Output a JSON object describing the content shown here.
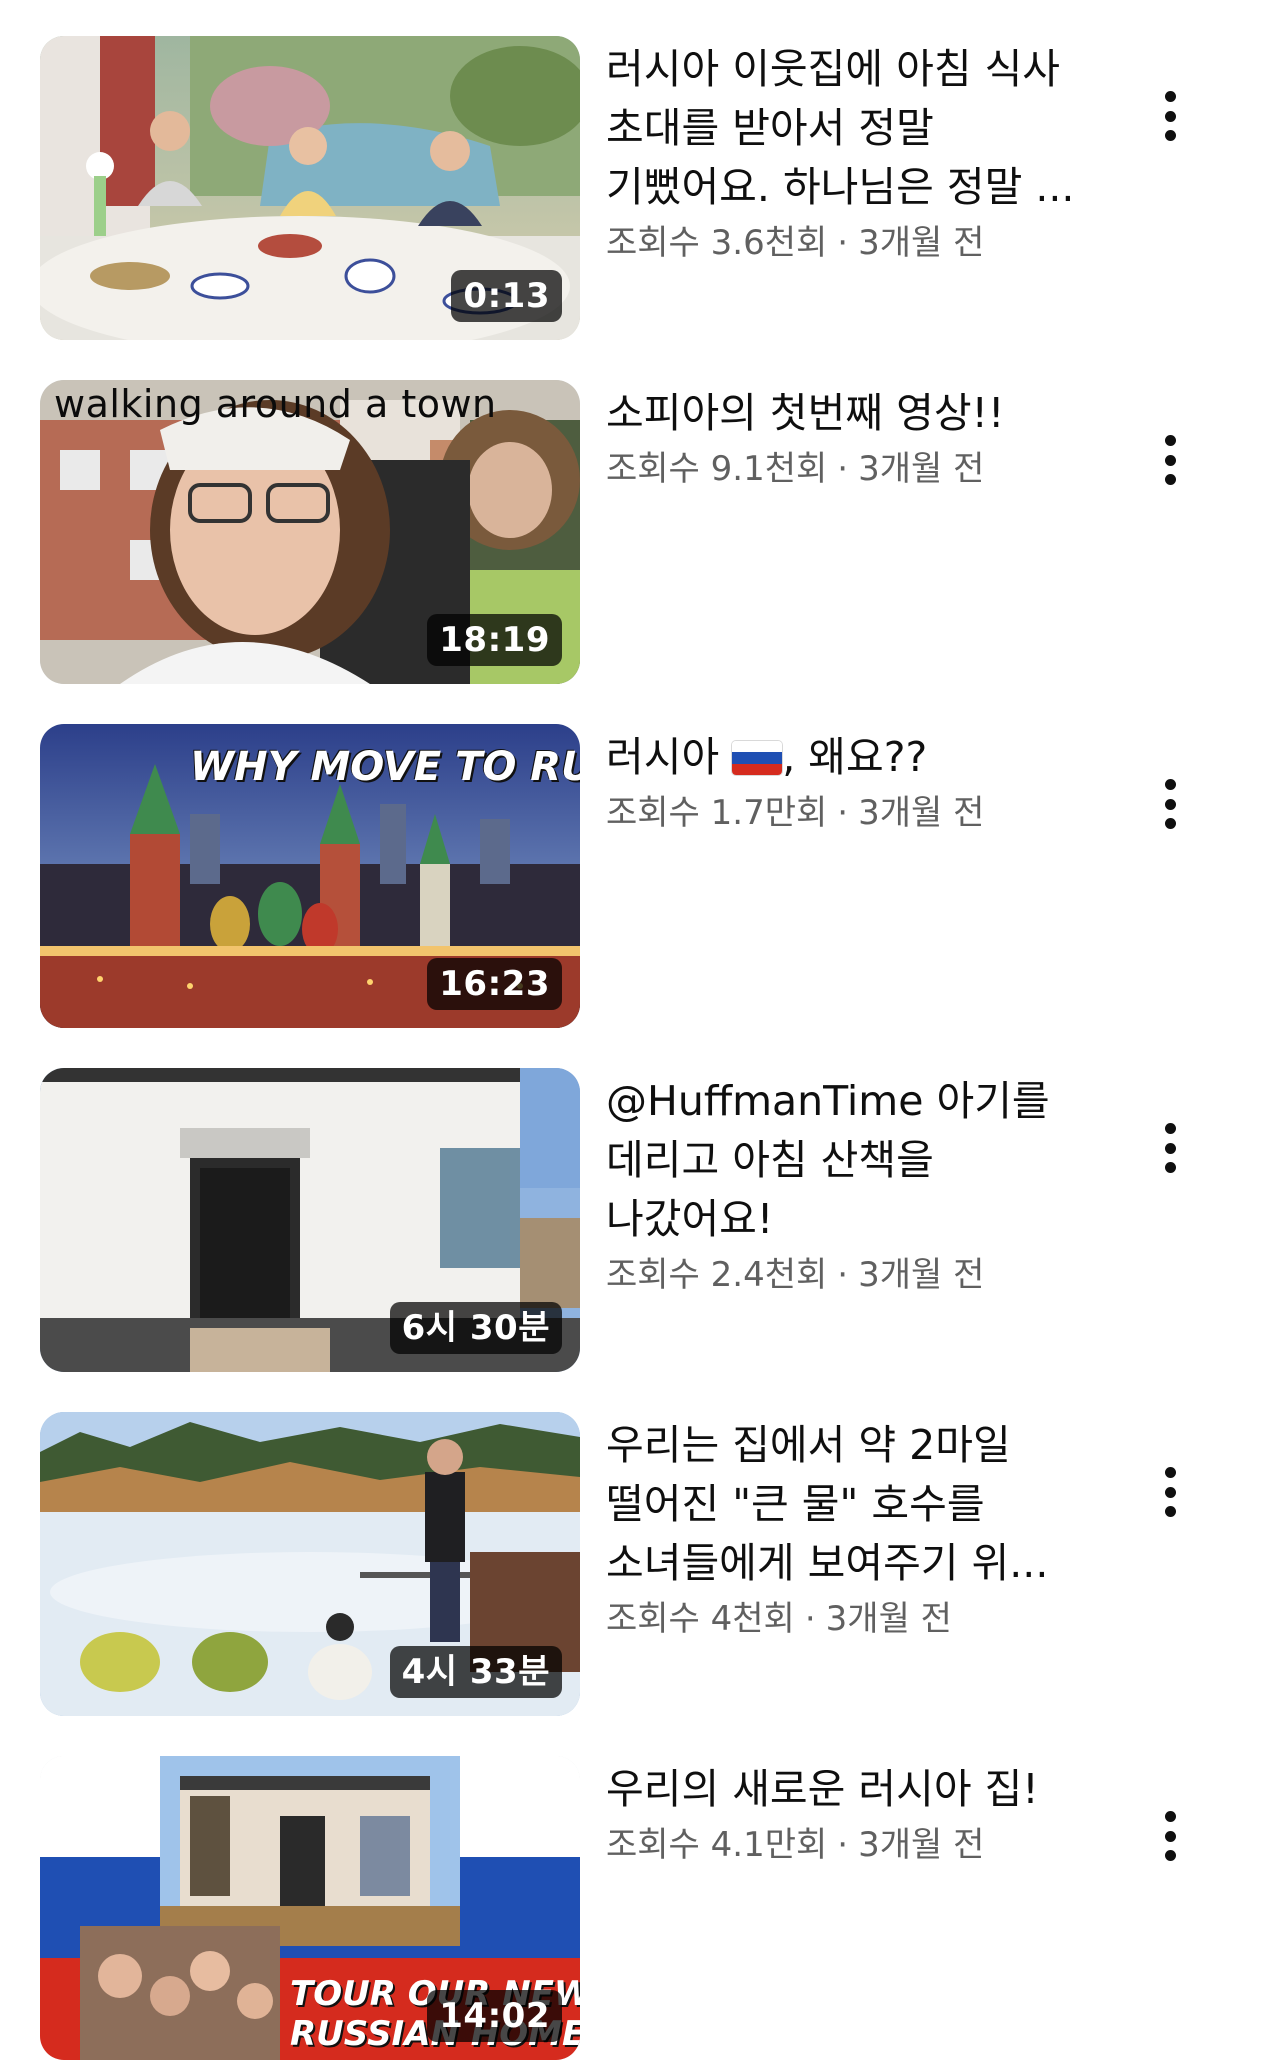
{
  "videos": [
    {
      "title": "러시아 이웃집에 아침 식사 초대를 받아서 정말 기뻤어요. 하나님은 정말 ...",
      "views": "조회수 3.6천회",
      "age": "3개월 전",
      "duration": "0:13",
      "thumbnail_text": ""
    },
    {
      "title": "소피아의 첫번째 영상!!",
      "views": "조회수 9.1천회",
      "age": "3개월 전",
      "duration": "18:19",
      "thumbnail_text": "walking around a town"
    },
    {
      "title_before_flag": "러시아 ",
      "title_after_flag": ", 왜요??",
      "views": "조회수 1.7만회",
      "age": "3개월 전",
      "duration": "16:23",
      "thumbnail_text": "WHY MOVE TO RUSSIA"
    },
    {
      "title": "@HuffmanTime 아기를 데리고 아침 산책을 나갔어요!",
      "views": "조회수 2.4천회",
      "age": "3개월 전",
      "duration": "6시 30분",
      "thumbnail_text": ""
    },
    {
      "title": "우리는 집에서 약 2마일 떨어진 \"큰 물\" 호수를 소녀들에게 보여주기 위...",
      "views": "조회수 4천회",
      "age": "3개월 전",
      "duration": "4시 33분",
      "thumbnail_text": ""
    },
    {
      "title": "우리의 새로운 러시아 집!",
      "views": "조회수 4.1만회",
      "age": "3개월 전",
      "duration": "14:02",
      "thumbnail_text_line1": "TOUR OUR NEW",
      "thumbnail_text_line2": "RUSSIAN HOME"
    }
  ],
  "meta_separator": "·",
  "icons": {
    "more": "more-vertical-icon",
    "flag": "russia-flag-emoji"
  },
  "colors": {
    "text_primary": "#0f0f0f",
    "text_secondary": "#606060",
    "duration_bg": "rgba(0,0,0,0.72)",
    "flag_white": "#ffffff",
    "flag_blue": "#1f4fb3",
    "flag_red": "#d52b1e"
  }
}
